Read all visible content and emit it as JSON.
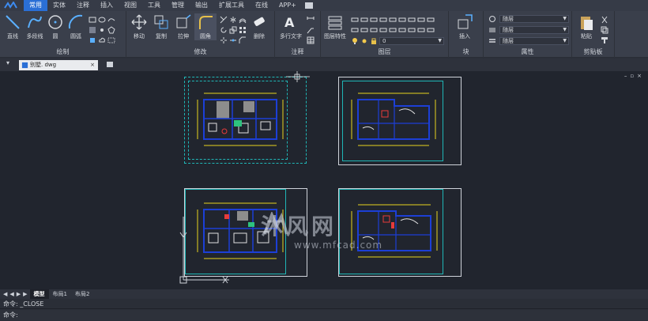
{
  "menu": {
    "tabs": [
      "常用",
      "实体",
      "注释",
      "插入",
      "视图",
      "工具",
      "管理",
      "输出",
      "扩展工具",
      "在线",
      "APP+"
    ],
    "active": 0
  },
  "ribbon": {
    "draw": {
      "label": "绘制",
      "buttons": [
        "直线",
        "多段线",
        "圆",
        "圆弧"
      ]
    },
    "modify": {
      "label": "修改",
      "buttons": [
        "移动",
        "复制",
        "拉伸",
        "圆角",
        "删除"
      ]
    },
    "annotation": {
      "label": "注释",
      "buttons": [
        "多行文字"
      ]
    },
    "layers": {
      "label": "图层",
      "buttons": [
        "图层特性"
      ],
      "current_layer": "0"
    },
    "block": {
      "label": "块",
      "buttons": [
        "插入"
      ]
    },
    "properties": {
      "label": "属性",
      "color": "随层",
      "linetype": "随层",
      "lineweight": "随层"
    },
    "clipboard": {
      "label": "剪贴板",
      "buttons": [
        "粘贴"
      ]
    }
  },
  "document": {
    "tab_name": "别墅. dwg",
    "close": "×"
  },
  "layout_tabs": [
    "模型",
    "布局1",
    "布局2"
  ],
  "active_layout": 0,
  "command": {
    "line1_prompt": "命令:",
    "line1_value": "_CLOSE",
    "line2_prompt": "命令:"
  },
  "watermark": {
    "brand": "沐风网",
    "url": "www.mfcad.com"
  },
  "colors": {
    "accent": "#2a6fd6",
    "canvas": "#21252e",
    "sheet_frame": "#1fb6b6"
  }
}
